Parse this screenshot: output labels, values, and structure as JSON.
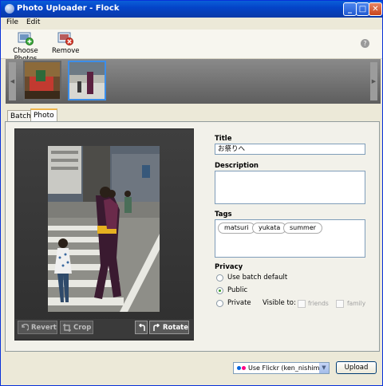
{
  "window": {
    "title": "Photo Uploader - Flock",
    "min": "_",
    "max": "□",
    "close": "✕"
  },
  "menu": [
    {
      "label": "File"
    },
    {
      "label": "Edit"
    }
  ],
  "toolbar": {
    "choose_photos": "Choose Photos",
    "remove": "Remove",
    "help": "?"
  },
  "strip": {
    "left_arrow": "◀",
    "right_arrow": "▶",
    "thumbnails": 2,
    "selected_index": 1
  },
  "tabs": [
    {
      "label": "Batch",
      "active": false
    },
    {
      "label": "Photo",
      "active": true
    }
  ],
  "editor": {
    "revert": "Revert",
    "crop": "Crop",
    "rotate": "Rotate"
  },
  "form": {
    "title_label": "Title",
    "title_value": "お祭りへ",
    "description_label": "Description",
    "description_value": "",
    "tags_label": "Tags",
    "tags": [
      "matsuri",
      "yukata",
      "summer"
    ],
    "privacy_label": "Privacy",
    "privacy_options": [
      {
        "label": "Use batch default",
        "selected": false
      },
      {
        "label": "Public",
        "selected": true
      },
      {
        "label": "Private",
        "selected": false
      }
    ],
    "visible_to_label": "Visible to:",
    "visible_friends": "friends",
    "visible_family": "family"
  },
  "account": {
    "selected": "Use Flickr (ken_nishimura)"
  },
  "upload_label": "Upload",
  "colors": {
    "title_bar": "#0a4fd0",
    "flickr_pink": "#ff0084",
    "flickr_blue": "#0063dc",
    "tab_accent": "#f0b54a"
  }
}
